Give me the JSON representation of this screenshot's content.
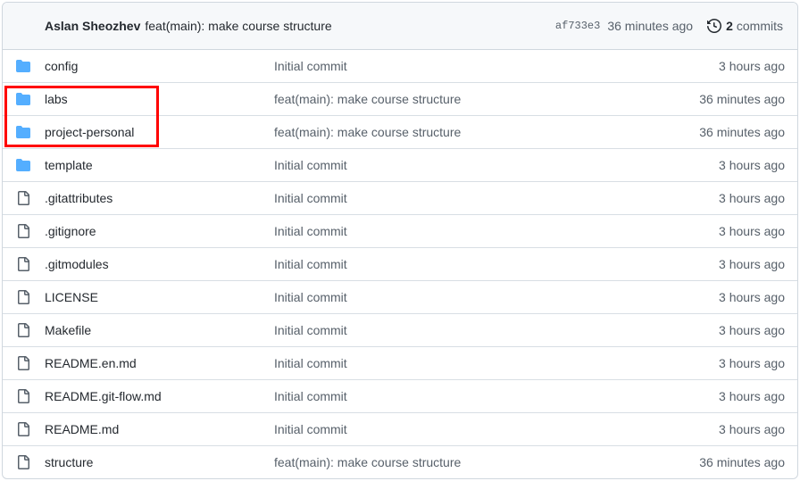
{
  "header": {
    "author": "Aslan Sheozhev",
    "message": "feat(main): make course structure",
    "sha": "af733e3",
    "time": "36 minutes ago",
    "commits_count": "2",
    "commits_label": "commits",
    "history_icon": "history-icon"
  },
  "files": [
    {
      "name": "config",
      "type": "folder",
      "message": "Initial commit",
      "age": "3 hours ago"
    },
    {
      "name": "labs",
      "type": "folder",
      "message": "feat(main): make course structure",
      "age": "36 minutes ago"
    },
    {
      "name": "project-personal",
      "type": "folder",
      "message": "feat(main): make course structure",
      "age": "36 minutes ago"
    },
    {
      "name": "template",
      "type": "folder",
      "message": "Initial commit",
      "age": "3 hours ago"
    },
    {
      "name": ".gitattributes",
      "type": "file",
      "message": "Initial commit",
      "age": "3 hours ago"
    },
    {
      "name": ".gitignore",
      "type": "file",
      "message": "Initial commit",
      "age": "3 hours ago"
    },
    {
      "name": ".gitmodules",
      "type": "file",
      "message": "Initial commit",
      "age": "3 hours ago"
    },
    {
      "name": "LICENSE",
      "type": "file",
      "message": "Initial commit",
      "age": "3 hours ago"
    },
    {
      "name": "Makefile",
      "type": "file",
      "message": "Initial commit",
      "age": "3 hours ago"
    },
    {
      "name": "README.en.md",
      "type": "file",
      "message": "Initial commit",
      "age": "3 hours ago"
    },
    {
      "name": "README.git-flow.md",
      "type": "file",
      "message": "Initial commit",
      "age": "3 hours ago"
    },
    {
      "name": "README.md",
      "type": "file",
      "message": "Initial commit",
      "age": "3 hours ago"
    },
    {
      "name": "structure",
      "type": "file",
      "message": "feat(main): make course structure",
      "age": "36 minutes ago"
    }
  ],
  "colors": {
    "folder": "#54aeff",
    "file": "#57606a",
    "highlight": "#ff0000"
  }
}
